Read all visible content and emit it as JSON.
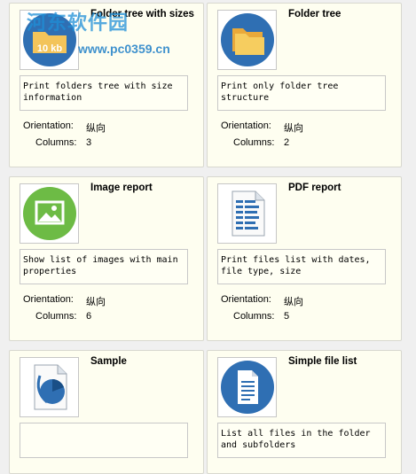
{
  "labels": {
    "orientation": "Orientation:",
    "columns": "Columns:"
  },
  "cards": [
    {
      "title": "Folder tree with sizes",
      "description": "Print folders tree with size information",
      "orientation": "纵向",
      "columns": "3",
      "icon": "folder-size-icon",
      "thumb_text": "10 kb"
    },
    {
      "title": "Folder tree",
      "description": "Print only folder tree structure",
      "orientation": "纵向",
      "columns": "2",
      "icon": "folder-icon"
    },
    {
      "title": "Image report",
      "description": "Show list of images with main properties",
      "orientation": "纵向",
      "columns": "6",
      "icon": "image-icon"
    },
    {
      "title": "PDF report",
      "description": "Print files list with dates, file type, size",
      "orientation": "纵向",
      "columns": "5",
      "icon": "pdf-document-icon"
    },
    {
      "title": "Sample",
      "description": "",
      "icon": "pie-chart-document-icon"
    },
    {
      "title": "Simple file list",
      "description": "List all files in the folder and subfolders",
      "icon": "document-icon"
    }
  ],
  "watermark": {
    "text": "河东软件园",
    "url": "www.pc0359.cn"
  },
  "colors": {
    "card_bg": "#fefef0",
    "accent_blue": "#2f6fb3",
    "image_green": "#6dbb45"
  }
}
